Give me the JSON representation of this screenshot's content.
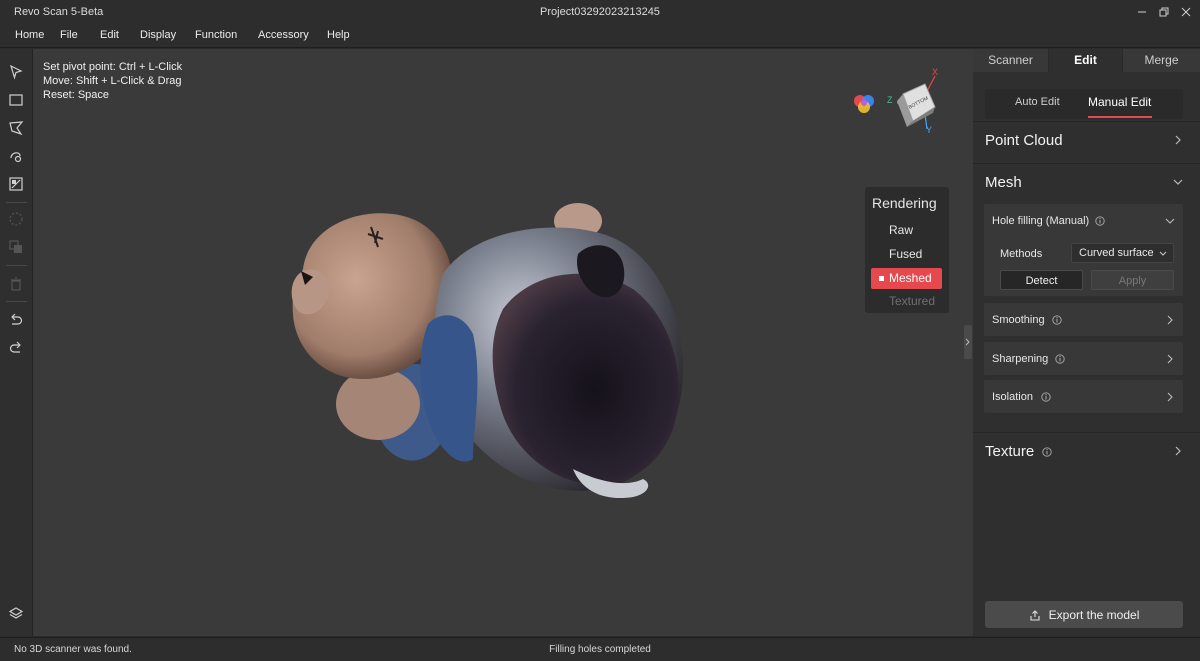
{
  "window": {
    "app_title": "Revo Scan 5-Beta",
    "project_title": "Project03292023213245"
  },
  "menu": [
    "Home",
    "File",
    "Edit",
    "Display",
    "Function",
    "Accessory",
    "Help"
  ],
  "viewport": {
    "hints": [
      "Set pivot point:  Ctrl + L-Click",
      "Move:  Shift + L-Click & Drag",
      "Reset:  Space"
    ],
    "view_cube_face": "BOTTOM",
    "axes": {
      "x": "X",
      "y": "Y",
      "z": "Z"
    },
    "rendering": {
      "title": "Rendering",
      "options": [
        {
          "label": "Raw",
          "state": "normal"
        },
        {
          "label": "Fused",
          "state": "normal"
        },
        {
          "label": "Meshed",
          "state": "active"
        },
        {
          "label": "Textured",
          "state": "disabled"
        }
      ]
    }
  },
  "right_panel": {
    "tabs": [
      "Scanner",
      "Edit",
      "Merge"
    ],
    "active_tab": "Edit",
    "subtabs": [
      "Auto Edit",
      "Manual Edit"
    ],
    "active_subtab": "Manual Edit",
    "sections": {
      "point_cloud": "Point Cloud",
      "mesh": "Mesh",
      "texture": "Texture"
    },
    "mesh_tools": {
      "hole_filling": {
        "title": "Hole filling (Manual)",
        "methods_label": "Methods",
        "method_value": "Curved surface",
        "detect_label": "Detect",
        "apply_label": "Apply"
      },
      "smoothing": "Smoothing",
      "sharpening": "Sharpening",
      "isolation": "Isolation"
    },
    "export_label": "Export the model"
  },
  "status": {
    "left": "No 3D scanner was found.",
    "center": "Filling holes completed"
  },
  "colors": {
    "accent": "#e5484d",
    "axis_x": "#e5484d",
    "axis_y": "#4aa3ff",
    "axis_z": "#3cc48a"
  }
}
